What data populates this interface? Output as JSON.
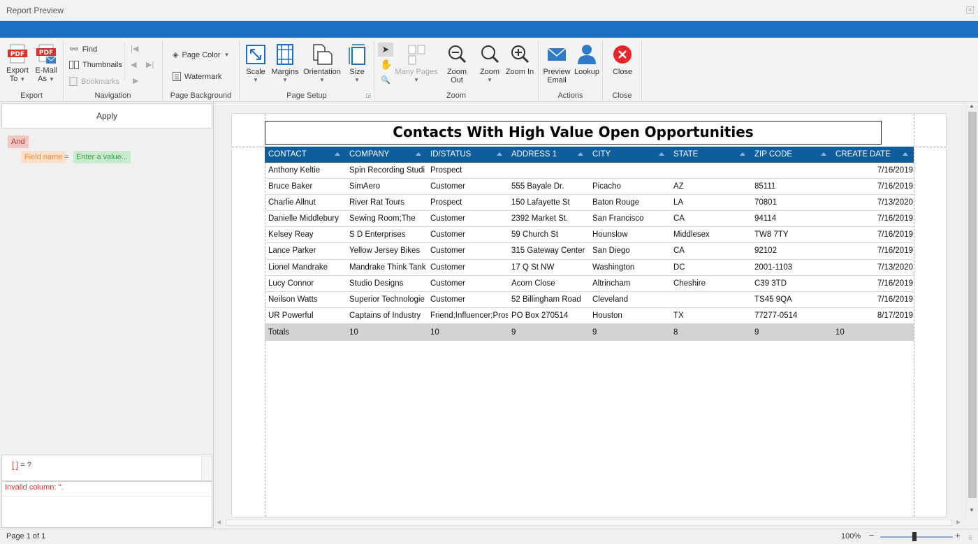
{
  "window": {
    "title": "Report Preview",
    "close_glyph": "×"
  },
  "ribbon": {
    "export": {
      "caption": "Export",
      "export_to": [
        "Export",
        "To"
      ],
      "email_as": [
        "E-Mail",
        "As"
      ]
    },
    "navigation": {
      "caption": "Navigation",
      "find": "Find",
      "thumbnails": "Thumbnails",
      "bookmarks": "Bookmarks"
    },
    "page_background": {
      "caption": "Page Background",
      "page_color": "Page Color",
      "watermark": "Watermark"
    },
    "page_setup": {
      "caption": "Page Setup",
      "scale": "Scale",
      "margins": "Margins",
      "orientation": "Orientation",
      "size": "Size"
    },
    "zoom": {
      "caption": "Zoom",
      "many_pages": "Many Pages",
      "zoom_out": "Zoom Out",
      "zoom": "Zoom",
      "zoom_in": "Zoom In"
    },
    "actions": {
      "caption": "Actions",
      "preview_email": [
        "Preview",
        "Email"
      ],
      "lookup": "Lookup"
    },
    "close": {
      "caption": "Close",
      "close": "Close"
    }
  },
  "filter": {
    "apply": "Apply",
    "group_op": "And",
    "field": "Field name",
    "operator": "=",
    "value_placeholder": "Enter a value...",
    "expression_bracket": "[ ]",
    "expression_rest": " = ?",
    "error": "Invalid column: ''."
  },
  "report": {
    "title": "Contacts With High Value Open Opportunities",
    "columns": [
      "CONTACT",
      "COMPANY",
      "ID/STATUS",
      "ADDRESS 1",
      "CITY",
      "STATE",
      "ZIP CODE",
      "CREATE DATE"
    ],
    "rows": [
      [
        "Anthony Keltie",
        "Spin Recording Studi",
        "Prospect",
        "",
        "",
        "",
        "",
        "7/16/2019"
      ],
      [
        "Bruce Baker",
        "SimAero",
        "Customer",
        "555 Bayale Dr.",
        "Picacho",
        "AZ",
        "85111",
        "7/16/2019"
      ],
      [
        "Charlie Allnut",
        "River Rat Tours",
        "Prospect",
        "150 Lafayette St",
        "Baton Rouge",
        "LA",
        "70801",
        "7/13/2020"
      ],
      [
        "Danielle Middlebury",
        "Sewing Room;The",
        "Customer",
        "2392 Market St.",
        "San Francisco",
        "CA",
        "94114",
        "7/16/2019"
      ],
      [
        "Kelsey Reay",
        "S D Enterprises",
        "Customer",
        "59 Church St",
        "Hounslow",
        "Middlesex",
        "TW8 7TY",
        "7/16/2019"
      ],
      [
        "Lance Parker",
        "Yellow Jersey Bikes",
        "Customer",
        "315 Gateway Center",
        "San Diego",
        "CA",
        "92102",
        "7/16/2019"
      ],
      [
        "Lionel Mandrake",
        "Mandrake Think Tank",
        "Customer",
        "17 Q St NW",
        "Washington",
        "DC",
        "2001-1103",
        "7/13/2020"
      ],
      [
        "Lucy Connor",
        "Studio Designs",
        "Customer",
        "Acorn Close",
        "Altrincham",
        "Cheshire",
        "C39 3TD",
        "7/16/2019"
      ],
      [
        "Neilson Watts",
        "Superior Technologie",
        "Customer",
        "52 Billingham Road",
        "Cleveland",
        "",
        "TS45 9QA",
        "7/16/2019"
      ],
      [
        "UR Powerful",
        "Captains of Industry",
        "Friend;Influencer;Pros",
        "PO Box 270514",
        "Houston",
        "TX",
        "77277-0514",
        "8/17/2019"
      ]
    ],
    "totals": [
      "Totals",
      "10",
      "10",
      "9",
      "9",
      "8",
      "9",
      "10"
    ]
  },
  "status": {
    "page": "Page 1 of 1",
    "zoom": "100%",
    "zoom_level_fraction": 0.47,
    "minus": "−",
    "plus": "+"
  },
  "colors": {
    "accent": "#1a71c6",
    "header": "#0f5d9d",
    "close_red": "#e8242a"
  }
}
